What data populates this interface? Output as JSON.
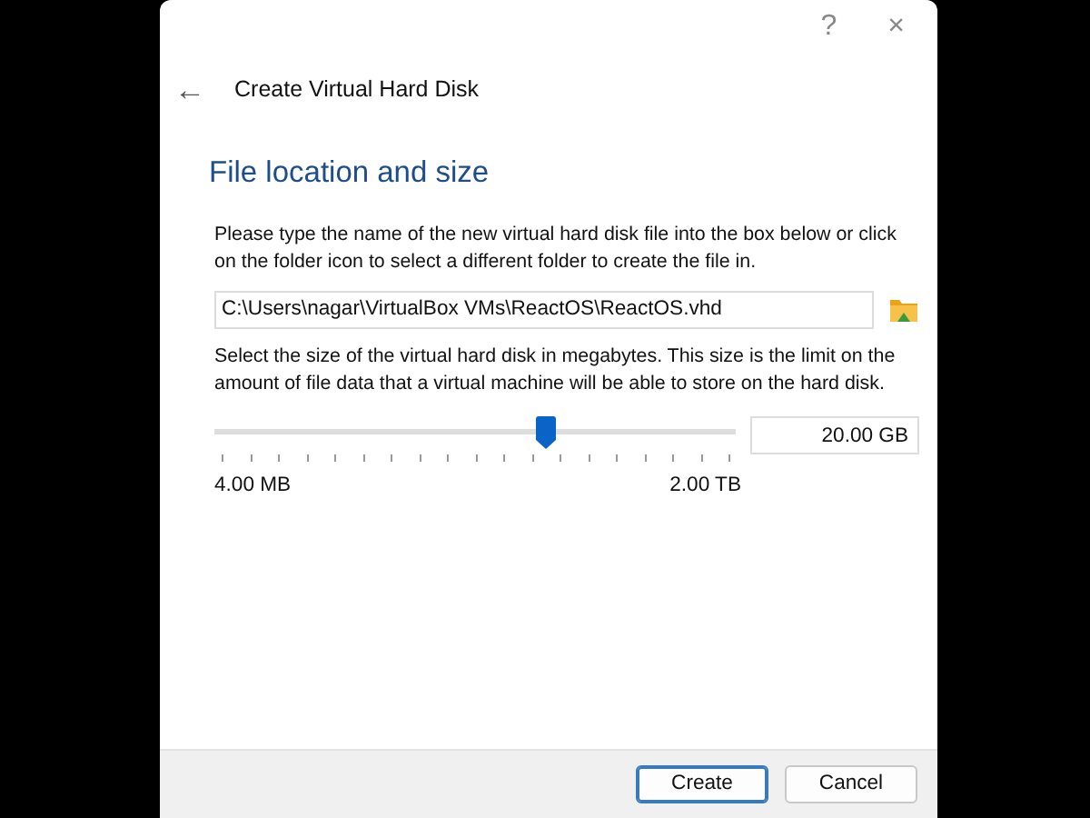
{
  "window": {
    "help": "?",
    "close": "×"
  },
  "header": {
    "back": "←",
    "title": "Create Virtual Hard Disk"
  },
  "section_title": "File location and size",
  "location_hint": "Please type the name of the new virtual hard disk file into the box below or click on the folder icon to select a different folder to create the file in.",
  "location_field": {
    "value": "C:\\Users\\nagar\\VirtualBox VMs\\ReactOS\\ReactOS.vhd"
  },
  "size_hint": "Select the size of the virtual hard disk in megabytes. This size is the limit on the amount of file data that a virtual machine will be able to store on the hard disk.",
  "size_slider": {
    "level": 0.635,
    "min_label": "4.00 MB",
    "max_label": "2.00 TB"
  },
  "size_field": {
    "value": "20.00 GB"
  },
  "buttons": [
    {
      "label": "Create",
      "default": true
    },
    {
      "label": "Cancel",
      "default": false
    }
  ]
}
